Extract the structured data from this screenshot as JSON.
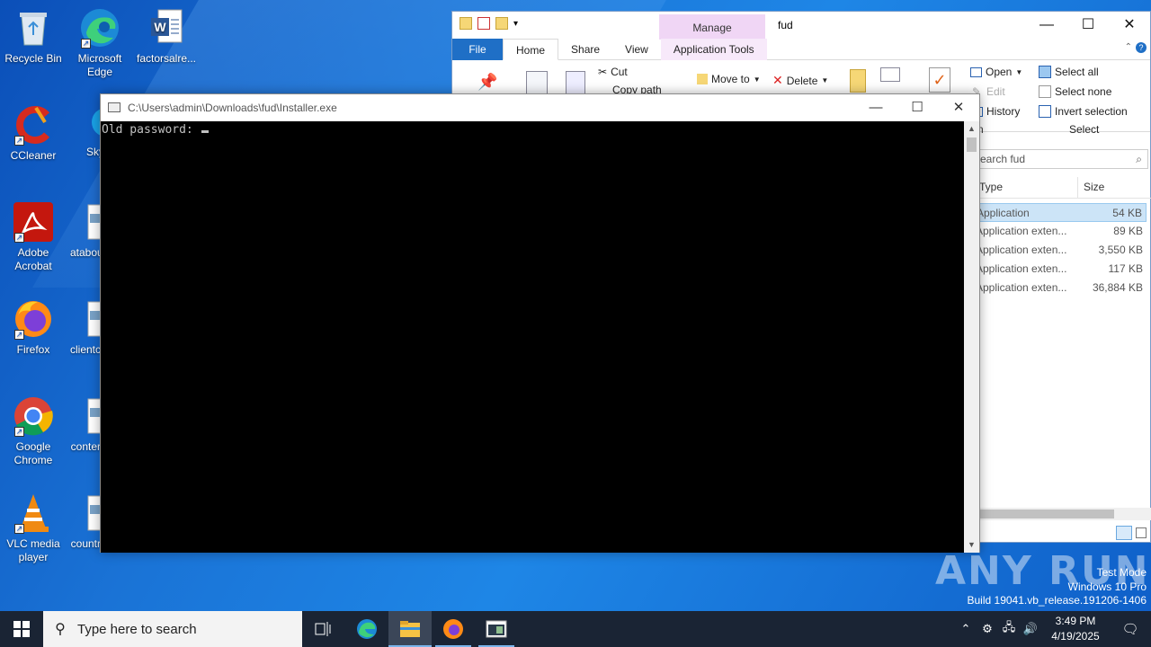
{
  "desktop": {
    "icons": [
      {
        "label": "Recycle Bin"
      },
      {
        "label": "Microsoft Edge"
      },
      {
        "label": "factorsalre..."
      },
      {
        "label": "CCleaner"
      },
      {
        "label": "Sky"
      },
      {
        "label": "Adobe Acrobat"
      },
      {
        "label": "atabou"
      },
      {
        "label": "Firefox"
      },
      {
        "label": "clientc"
      },
      {
        "label": "Google Chrome"
      },
      {
        "label": "conter"
      },
      {
        "label": "VLC media player"
      },
      {
        "label": "countr"
      }
    ]
  },
  "explorer": {
    "title": "fud",
    "manage_label": "Manage",
    "tabs": [
      "File",
      "Home",
      "Share",
      "View",
      "Application Tools"
    ],
    "ribbon": {
      "cut": "Cut",
      "copy_path": "Copy path",
      "move_to": "Move to",
      "delete": "Delete",
      "open": "Open",
      "edit": "Edit",
      "history": "History",
      "select_all": "Select all",
      "select_none": "Select none",
      "invert_selection": "Invert selection",
      "select_group": "Select",
      "open_group_fragment": "n"
    },
    "search_placeholder": "earch fud",
    "columns": {
      "type": "Type",
      "size": "Size"
    },
    "files": [
      {
        "type": "Application",
        "size": "54 KB",
        "selected": true
      },
      {
        "type": "Application exten...",
        "size": "89 KB"
      },
      {
        "type": "Application exten...",
        "size": "3,550 KB"
      },
      {
        "type": "Application exten...",
        "size": "117 KB"
      },
      {
        "type": "Application exten...",
        "size": "36,884 KB"
      }
    ]
  },
  "console": {
    "title": "C:\\Users\\admin\\Downloads\\fud\\Installer.exe",
    "prompt": "Old password: "
  },
  "watermark": {
    "brand": "ANY RUN",
    "line1": "Test Mode",
    "line2": "Windows 10 Pro",
    "line3": "Build 19041.vb_release.191206-1406"
  },
  "taskbar": {
    "search_placeholder": "Type here to search",
    "time": "3:49 PM",
    "date": "4/19/2025"
  }
}
